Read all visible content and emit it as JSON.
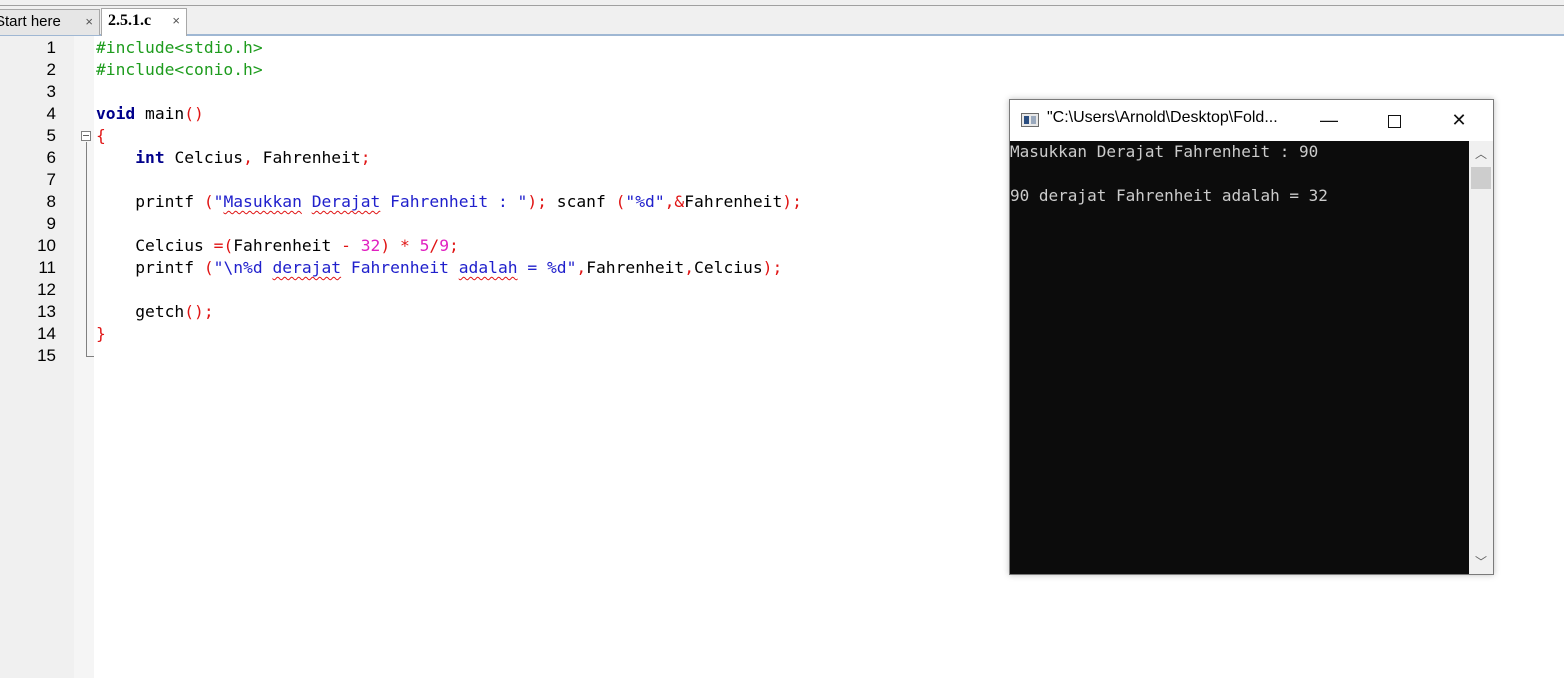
{
  "tabs": [
    {
      "label": "Start here",
      "close": "×"
    },
    {
      "label": "2.5.1.c",
      "close": "×"
    }
  ],
  "editor": {
    "line_numbers": [
      "1",
      "2",
      "3",
      "4",
      "5",
      "6",
      "7",
      "8",
      "9",
      "10",
      "11",
      "12",
      "13",
      "14",
      "15"
    ]
  },
  "console": {
    "title": "\"C:\\Users\\Arnold\\Desktop\\Fold...",
    "minimize": "—",
    "close": "✕",
    "output": [
      "Masukkan Derajat Fahrenheit : 90",
      "",
      "90 derajat Fahrenheit adalah = 32"
    ],
    "scroll_up": "︿",
    "scroll_down": "﹀"
  }
}
